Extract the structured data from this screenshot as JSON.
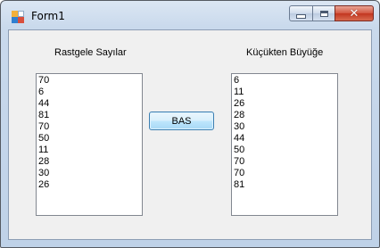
{
  "window": {
    "title": "Form1",
    "icon": "app-form-icon"
  },
  "caption_buttons": {
    "minimize": "minimize-icon",
    "maximize": "maximize-icon",
    "close_glyph": "✕"
  },
  "left_panel": {
    "label": "Rastgele Sayılar",
    "items": [
      "70",
      "6",
      "44",
      "81",
      "70",
      "50",
      "11",
      "28",
      "30",
      "26"
    ]
  },
  "right_panel": {
    "label": "Küçükten Büyüğe",
    "items": [
      "6",
      "11",
      "26",
      "28",
      "30",
      "44",
      "50",
      "70",
      "70",
      "81"
    ]
  },
  "action_button": {
    "label": "BAS"
  }
}
